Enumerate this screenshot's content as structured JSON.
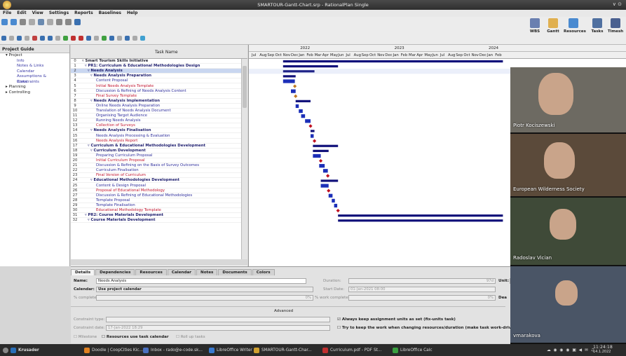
{
  "window": {
    "title": "SMARTOUR-Gantt-Chart.srp - RationalPlan Single",
    "app": "RationalPlan",
    "controls": "∨ ⊙"
  },
  "menu": [
    "File",
    "Edit",
    "View",
    "Settings",
    "Reports",
    "Baselines",
    "Help"
  ],
  "big_tools": [
    {
      "label": "WBS",
      "color": "#6a7fb0"
    },
    {
      "label": "Gantt",
      "color": "#e0b050"
    },
    {
      "label": "Resources",
      "color": "#4a8ad0"
    },
    {
      "label": "Tasks",
      "color": "#5070a0"
    },
    {
      "label": "Timesh",
      "color": "#4a6090"
    }
  ],
  "guide": {
    "title": "Project Guide",
    "items": [
      {
        "label": "▾ Project",
        "sub": false
      },
      {
        "label": "Info",
        "sub": true
      },
      {
        "label": "Notes & Links",
        "sub": true
      },
      {
        "label": "Calendar",
        "sub": true
      },
      {
        "label": "Assumptions & Constraints",
        "sub": true
      },
      {
        "label": "Risks",
        "sub": true
      },
      {
        "label": "▸ Planning",
        "sub": false
      },
      {
        "label": "▸ Controlling",
        "sub": false
      }
    ]
  },
  "task_header": "Task Name",
  "tasks": [
    {
      "n": "0",
      "t": "▿ Smart Tourism Skills Initiative",
      "s": "b2",
      "i": 0
    },
    {
      "n": "1",
      "t": "▿ PR1: Curriculum & Educational Methodologies Design",
      "s": "b",
      "i": 1
    },
    {
      "n": "2",
      "t": "▿ Needs Analysis",
      "s": "b",
      "i": 2,
      "sel": true
    },
    {
      "n": "3",
      "t": "▿ Needs Analysis Preparation",
      "s": "b",
      "i": 3
    },
    {
      "n": "4",
      "t": "Content Proposal",
      "s": "blue",
      "i": 5
    },
    {
      "n": "5",
      "t": "Initial Needs Analysis Template",
      "s": "red",
      "i": 5
    },
    {
      "n": "6",
      "t": "Discussion & Refining of Needs Analysis Content",
      "s": "blue",
      "i": 5
    },
    {
      "n": "7",
      "t": "Final Survey Template",
      "s": "red",
      "i": 5
    },
    {
      "n": "8",
      "t": "▿ Needs Analysis Implementation",
      "s": "b",
      "i": 3
    },
    {
      "n": "9",
      "t": "Online Needs Analysis Preparation",
      "s": "blue",
      "i": 5
    },
    {
      "n": "10",
      "t": "Translation of Needs Analysis Document",
      "s": "blue",
      "i": 5
    },
    {
      "n": "11",
      "t": "Organising Target Audience",
      "s": "blue",
      "i": 5
    },
    {
      "n": "12",
      "t": "Running Needs Analysis",
      "s": "blue",
      "i": 5
    },
    {
      "n": "13",
      "t": "Collection of Surveys",
      "s": "red",
      "i": 5
    },
    {
      "n": "14",
      "t": "▿ Needs Analysis Finalisation",
      "s": "b",
      "i": 3
    },
    {
      "n": "15",
      "t": "Needs Analysis Processing & Evaluation",
      "s": "blue",
      "i": 5
    },
    {
      "n": "16",
      "t": "Needs Analysis Report",
      "s": "red",
      "i": 5
    },
    {
      "n": "17",
      "t": "▿ Curriculum & Educational Methodologies Development",
      "s": "b",
      "i": 2
    },
    {
      "n": "18",
      "t": "▿ Curriculum Development",
      "s": "b",
      "i": 3
    },
    {
      "n": "19",
      "t": "Preparing Curriculum Proposal",
      "s": "blue",
      "i": 5
    },
    {
      "n": "20",
      "t": "Initial Curriculum Proposal",
      "s": "red",
      "i": 5
    },
    {
      "n": "21",
      "t": "Discussion & Refining on the Basis of Survey Outcomes",
      "s": "blue",
      "i": 5
    },
    {
      "n": "22",
      "t": "Curriculum Finalisation",
      "s": "blue",
      "i": 5
    },
    {
      "n": "23",
      "t": "Final Version of Curriculum",
      "s": "red",
      "i": 5
    },
    {
      "n": "24",
      "t": "▿ Educational Methodologies Development",
      "s": "b",
      "i": 3
    },
    {
      "n": "25",
      "t": "Content & Design Proposal",
      "s": "blue",
      "i": 5
    },
    {
      "n": "26",
      "t": "Proposal of Educational Methodology",
      "s": "red",
      "i": 5
    },
    {
      "n": "27",
      "t": "Discussion & Refining of Educational Methodologies",
      "s": "blue",
      "i": 5
    },
    {
      "n": "28",
      "t": "Template Proposal",
      "s": "blue",
      "i": 5
    },
    {
      "n": "29",
      "t": "Template Finalisation",
      "s": "blue",
      "i": 5
    },
    {
      "n": "30",
      "t": "Educational Methodology Template",
      "s": "red",
      "i": 5
    },
    {
      "n": "31",
      "t": "▿ PR2: Course Materials Development",
      "s": "b",
      "i": 1
    },
    {
      "n": "32",
      "t": "▿ Course Materials Development",
      "s": "b",
      "i": 2
    }
  ],
  "gantt": {
    "years": [
      {
        "label": "2022",
        "m": 6
      },
      {
        "label": "2023",
        "m": 18
      },
      {
        "label": "2024",
        "m": 30
      }
    ],
    "months": [
      "Jul",
      "Aug",
      "Sep",
      "Oct",
      "Nov",
      "Dec",
      "Jan",
      "Feb",
      "Mar",
      "Apr",
      "May",
      "Jun",
      "Jul",
      "Aug",
      "Sep",
      "Oct",
      "Nov",
      "Dec",
      "Jan",
      "Feb",
      "Mar",
      "Apr",
      "May",
      "Jun",
      "Jul",
      "Aug",
      "Sep",
      "Oct",
      "Nov",
      "Dec",
      "Jan",
      "Feb"
    ],
    "bars": [
      {
        "row": 0,
        "start": 4.0,
        "end": 32,
        "kind": "sum"
      },
      {
        "row": 1,
        "start": 4.0,
        "end": 11.0,
        "kind": "sum"
      },
      {
        "row": 2,
        "start": 4.0,
        "end": 8.0,
        "kind": "sum"
      },
      {
        "row": 3,
        "start": 4.0,
        "end": 5.6,
        "kind": "sum"
      },
      {
        "row": 4,
        "start": 4.0,
        "end": 5.5,
        "kind": "task"
      },
      {
        "row": 5,
        "start": 5.5,
        "end": 5.5,
        "kind": "ms"
      },
      {
        "row": 6,
        "start": 5.0,
        "end": 5.6,
        "kind": "task"
      },
      {
        "row": 7,
        "start": 5.6,
        "end": 5.6,
        "kind": "ms"
      },
      {
        "row": 8,
        "start": 5.6,
        "end": 7.5,
        "kind": "sum"
      },
      {
        "row": 9,
        "start": 5.6,
        "end": 6.0,
        "kind": "task"
      },
      {
        "row": 10,
        "start": 6.0,
        "end": 6.5,
        "kind": "task"
      },
      {
        "row": 11,
        "start": 6.3,
        "end": 6.8,
        "kind": "task"
      },
      {
        "row": 12,
        "start": 6.8,
        "end": 7.5,
        "kind": "task"
      },
      {
        "row": 13,
        "start": 7.5,
        "end": 7.5,
        "kind": "ms"
      },
      {
        "row": 14,
        "start": 7.5,
        "end": 8.0,
        "kind": "sum"
      },
      {
        "row": 15,
        "start": 7.5,
        "end": 7.9,
        "kind": "task"
      },
      {
        "row": 16,
        "start": 8.0,
        "end": 8.0,
        "kind": "ms"
      },
      {
        "row": 17,
        "start": 7.8,
        "end": 11.0,
        "kind": "sum"
      },
      {
        "row": 18,
        "start": 7.8,
        "end": 9.8,
        "kind": "sum"
      },
      {
        "row": 19,
        "start": 7.8,
        "end": 8.8,
        "kind": "task"
      },
      {
        "row": 20,
        "start": 8.8,
        "end": 8.8,
        "kind": "ms"
      },
      {
        "row": 21,
        "start": 8.6,
        "end": 9.3,
        "kind": "task"
      },
      {
        "row": 22,
        "start": 9.1,
        "end": 9.7,
        "kind": "task"
      },
      {
        "row": 23,
        "start": 9.7,
        "end": 9.7,
        "kind": "ms"
      },
      {
        "row": 24,
        "start": 8.8,
        "end": 11.0,
        "kind": "sum"
      },
      {
        "row": 25,
        "start": 8.8,
        "end": 9.8,
        "kind": "task"
      },
      {
        "row": 26,
        "start": 9.8,
        "end": 9.8,
        "kind": "ms"
      },
      {
        "row": 27,
        "start": 9.8,
        "end": 10.3,
        "kind": "task"
      },
      {
        "row": 28,
        "start": 10.2,
        "end": 10.6,
        "kind": "task"
      },
      {
        "row": 29,
        "start": 10.5,
        "end": 10.9,
        "kind": "task"
      },
      {
        "row": 30,
        "start": 11.0,
        "end": 11.0,
        "kind": "ms"
      },
      {
        "row": 31,
        "start": 11.0,
        "end": 32,
        "kind": "sum"
      },
      {
        "row": 32,
        "start": 11.0,
        "end": 32,
        "kind": "sum"
      }
    ]
  },
  "details": {
    "tabs": [
      "Details",
      "Dependencies",
      "Resources",
      "Calendar",
      "Notes",
      "Documents",
      "Colors"
    ],
    "name_label": "Name:",
    "name_value": "Needs Analysis",
    "calendar_label": "Calendar:",
    "calendar_value": "Use project calendar",
    "complete_label": "% complete:",
    "complete_value": "0%",
    "duration_label": "Duration:",
    "duration_value": "97d",
    "unit_label": "Unit:",
    "unit_value": "d",
    "start_label": "Start Date:",
    "start_value": "01-Jan-2021 08:00",
    "work_label": "% work complete:",
    "work_value": "0%",
    "dea_label": "Dea",
    "advanced": "Advanced",
    "constraint_type_label": "Constraint type:",
    "constraint_date_label": "Constraint date:",
    "constraint_date_value": "17-Jan-2022 18:29",
    "always_keep": "Always keep assignment units as set (fix-units task)",
    "try_keep": "Try to keep the work when changing resources/duration (make task work-driven)",
    "milestone": "Milestone",
    "use_cal": "Resources use task calendar",
    "rollup": "Roll up tasks"
  },
  "video": [
    {
      "name": "Piotr Kociszewski",
      "bg": "#6d6a62"
    },
    {
      "name": "European Wilderness Society",
      "bg": "#5b4a3a"
    },
    {
      "name": "Radoslav Vician",
      "bg": "#3f4a38"
    },
    {
      "name": "vmarakova",
      "bg": "#4a5566"
    }
  ],
  "taskbar": {
    "start": "Krusader",
    "items": [
      {
        "label": "Doodle | CoopCities Kic...",
        "color": "#e08020"
      },
      {
        "label": "Inbox - rado@e-code.sk...",
        "color": "#4a70c0"
      },
      {
        "label": "LibreOffice Writer",
        "color": "#3a7ad0"
      },
      {
        "label": "SMARTOUR-Gantt-Char...",
        "color": "#d0a030"
      },
      {
        "label": "Curriculum.pdf - PDF St...",
        "color": "#c03030"
      },
      {
        "label": "LibreOffice Calc",
        "color": "#3aa040"
      }
    ],
    "clock": "11:24:18",
    "date": "14.1.2022"
  }
}
